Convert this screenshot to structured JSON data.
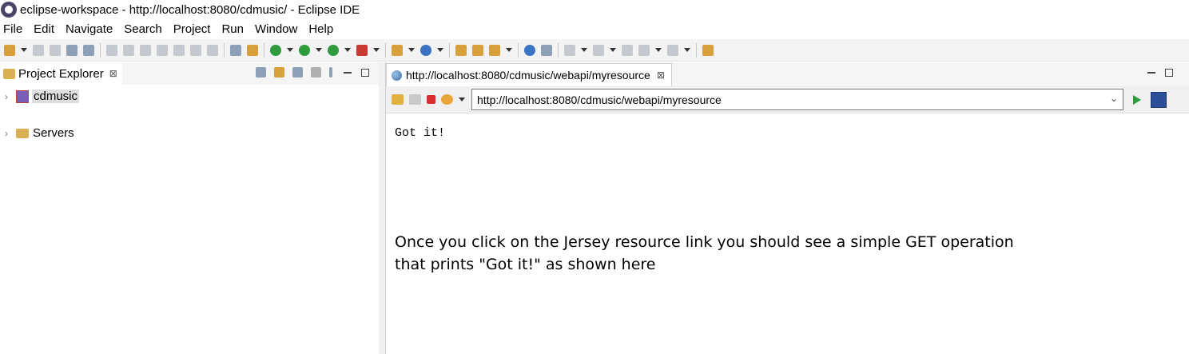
{
  "window": {
    "title": "eclipse-workspace - http://localhost:8080/cdmusic/ - Eclipse IDE"
  },
  "menubar": {
    "items": [
      "File",
      "Edit",
      "Navigate",
      "Search",
      "Project",
      "Run",
      "Window",
      "Help"
    ]
  },
  "project_explorer": {
    "tab_label": "Project Explorer",
    "tab_close": "⊠",
    "tree": [
      {
        "label": "cdmusic",
        "selected": true,
        "icon": "java-project-icon"
      },
      {
        "label": "Servers",
        "selected": false,
        "icon": "folder-icon"
      }
    ]
  },
  "browser": {
    "tab_label": "http://localhost:8080/cdmusic/webapi/myresource",
    "tab_close": "⊠",
    "url": "http://localhost:8080/cdmusic/webapi/myresource",
    "content_text": "Got it!"
  },
  "annotation": {
    "line1": "Once you click on the Jersey resource link you should see a simple GET operation",
    "line2": "that prints \"Got it!\" as shown here"
  }
}
